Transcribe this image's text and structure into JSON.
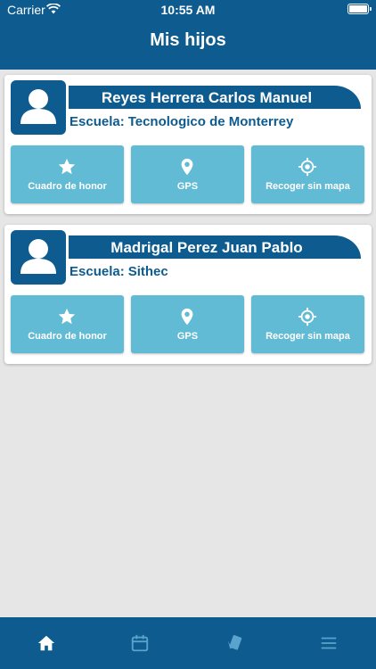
{
  "status_bar": {
    "carrier": "Carrier",
    "time": "10:55 AM"
  },
  "header": {
    "title": "Mis hijos"
  },
  "children": [
    {
      "name": "Reyes Herrera Carlos Manuel",
      "school_label": "Escuela:",
      "school": "Tecnologico de Monterrey",
      "buttons": [
        {
          "label": "Cuadro de honor",
          "icon": "star-icon"
        },
        {
          "label": "GPS",
          "icon": "location-pin-icon"
        },
        {
          "label": "Recoger sin mapa",
          "icon": "crosshair-icon"
        }
      ]
    },
    {
      "name": "Madrigal Perez Juan Pablo",
      "school_label": "Escuela:",
      "school": "Sithec",
      "buttons": [
        {
          "label": "Cuadro de honor",
          "icon": "star-icon"
        },
        {
          "label": "GPS",
          "icon": "location-pin-icon"
        },
        {
          "label": "Recoger sin mapa",
          "icon": "crosshair-icon"
        }
      ]
    }
  ],
  "tab_bar": {
    "items": [
      {
        "icon": "home-icon",
        "active": true
      },
      {
        "icon": "calendar-icon",
        "active": false
      },
      {
        "icon": "cards-icon",
        "active": false
      },
      {
        "icon": "menu-icon",
        "active": false
      }
    ]
  },
  "colors": {
    "primary": "#0d5b8f",
    "button": "#62bbd4",
    "background": "#e6e6e6",
    "tab_inactive": "#5aa3cc"
  }
}
